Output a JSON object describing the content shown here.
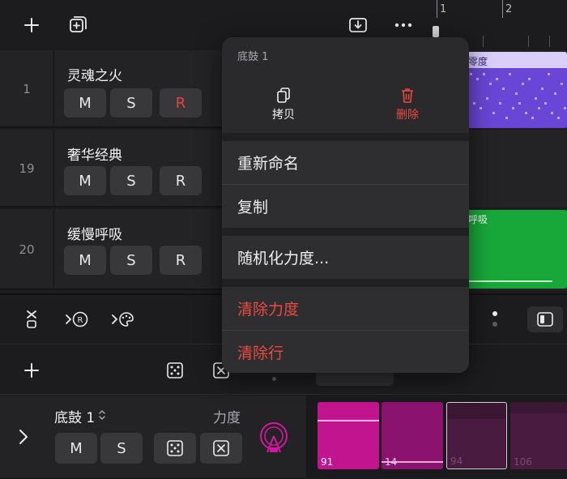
{
  "toolbar": {
    "add_icon": "plus-icon",
    "add_track_icon": "add-square-icon",
    "download_icon": "tray-download-icon",
    "more_icon": "ellipsis-icon"
  },
  "ruler": {
    "marks": [
      "1",
      "2"
    ]
  },
  "tracks": [
    {
      "number": "1",
      "name": "灵魂之火",
      "m": "M",
      "s": "S",
      "r": "R",
      "r_armed": true
    },
    {
      "number": "19",
      "name": "奢华经典",
      "m": "M",
      "s": "S",
      "r": "R",
      "r_armed": false
    },
    {
      "number": "20",
      "name": "缓慢呼吸",
      "m": "M",
      "s": "S",
      "r": "R",
      "r_armed": false
    }
  ],
  "regions": [
    {
      "label": "零度",
      "color": "#6a46d6"
    },
    {
      "label": "呼吸",
      "color": "#18a83a"
    }
  ],
  "menu": {
    "title": "底鼓 1",
    "copy_label": "拷贝",
    "delete_label": "删除",
    "items": [
      {
        "label": "重新命名",
        "destructive": false
      },
      {
        "label": "复制",
        "destructive": false
      },
      {
        "label": "随机化力度...",
        "destructive": false
      },
      {
        "label": "清除力度",
        "destructive": true
      },
      {
        "label": "清除行",
        "destructive": true
      }
    ]
  },
  "editor": {
    "row_name": "底鼓 1",
    "velocity_label": "力度",
    "m": "M",
    "s": "S",
    "cells": [
      {
        "value": "91",
        "velocity": 0.73,
        "active": true
      },
      {
        "value": "14",
        "velocity": 0.12,
        "active": true
      },
      {
        "value": "94",
        "velocity": 0.75,
        "active": false
      },
      {
        "value": "106",
        "velocity": 0.85,
        "active": false
      }
    ]
  },
  "colors": {
    "accent_pink": "#c2148f",
    "record_red": "#e5453a",
    "destructive_red": "#ea4a3f"
  }
}
